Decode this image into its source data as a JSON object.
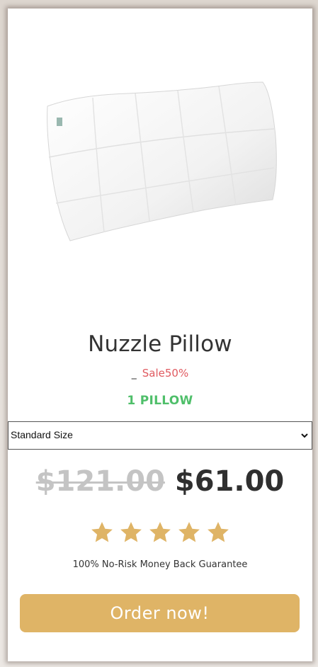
{
  "product": {
    "title": "Nuzzle Pillow",
    "sale_dash": "_",
    "sale_label": "Sale50%",
    "quantity_label": "1 PILLOW"
  },
  "size_select": {
    "selected": "Standard Size"
  },
  "pricing": {
    "original_price": "$121.00",
    "current_price": "$61.00"
  },
  "rating": {
    "stars": 5,
    "max": 5
  },
  "guarantee_text": "100% No-Risk Money Back Guarantee",
  "order_button_label": "Order now!",
  "colors": {
    "sale_red": "#e05a60",
    "quantity_green": "#4fbf6a",
    "star_gold": "#dfb466",
    "button_gold": "#dfb466"
  },
  "icons": {
    "select_arrow": "chevron-down-icon",
    "rating": "star-icon"
  }
}
